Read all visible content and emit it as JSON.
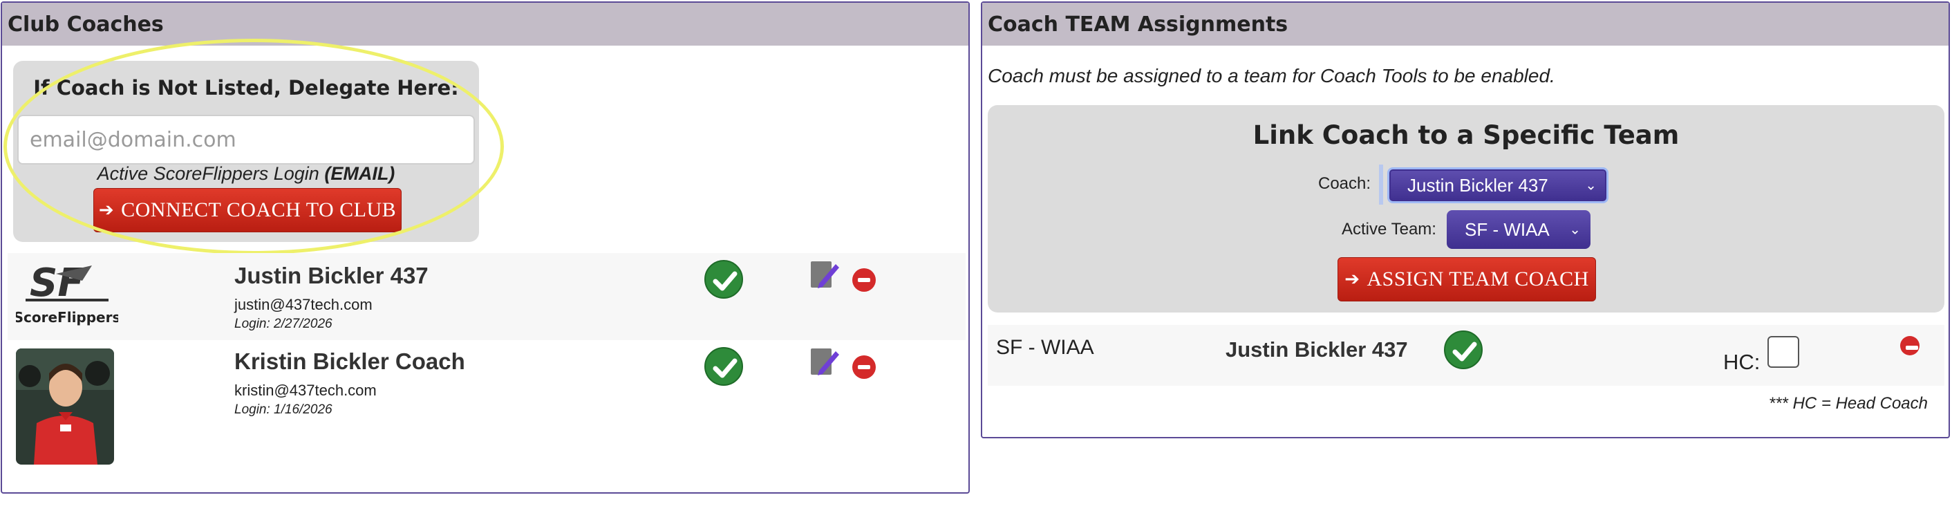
{
  "club_coaches": {
    "header": "Club Coaches",
    "delegate": {
      "title": "If Coach is Not Listed, Delegate Here:",
      "email_placeholder": "email@domain.com",
      "hint_prefix": "Active ScoreFlippers Login ",
      "hint_bold": "(EMAIL)",
      "connect_label": "CONNECT COACH TO CLUB"
    },
    "coaches": [
      {
        "name": "Justin Bickler 437",
        "email": "justin@437tech.com",
        "login": "Login: 2/27/2026",
        "logo_text": "ScoreFlippers"
      },
      {
        "name": "Kristin Bickler Coach",
        "email": "kristin@437tech.com",
        "login": "Login: 1/16/2026"
      }
    ]
  },
  "assignments": {
    "header": "Coach TEAM Assignments",
    "note": "Coach must be assigned to a team for Coach Tools to be enabled.",
    "link_title": "Link Coach to a Specific Team",
    "coach_label": "Coach:",
    "coach_value": "Justin Bickler 437",
    "team_label": "Active Team:",
    "team_value": "SF - WIAA",
    "assign_label": "ASSIGN TEAM COACH",
    "rows": [
      {
        "team": "SF - WIAA",
        "coach": "Justin Bickler 437",
        "hc_label": "HC:"
      }
    ],
    "hc_note": "*** HC = Head Coach"
  },
  "colors": {
    "header_bg": "#c3bcc7",
    "panel_border": "#5b4a96",
    "button_red": "#d02a1c",
    "select_purple": "#4f3fa0",
    "check_green": "#2e8b3a",
    "highlight_yellow": "#eef06a"
  }
}
